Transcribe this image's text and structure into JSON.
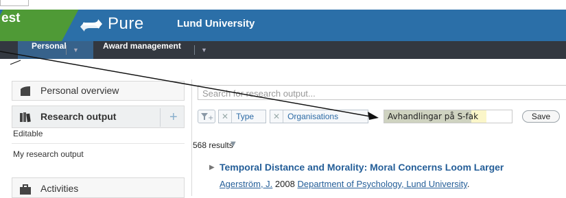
{
  "header": {
    "environment_label": "est",
    "product_name": "Pure",
    "organization": "Lund University"
  },
  "nav": {
    "personal": "Personal",
    "award_management": "Award management"
  },
  "sidebar": {
    "overview": "Personal overview",
    "research_output": "Research output",
    "editable": "Editable",
    "my_research_output": "My research output",
    "activities": "Activities"
  },
  "main": {
    "search_placeholder": "Search for research output...",
    "filters": {
      "type": "Type",
      "organisations": "Organisations",
      "saved_filter_value": "Avhandlingar på S-fak",
      "save_label": "Save"
    },
    "results_count": "568 results",
    "result": {
      "title": "Temporal Distance and Morality: Moral Concerns Loom Larger",
      "author": "Agerström, J.",
      "year": "2008",
      "department": "Department of Psychology, Lund University",
      "suffix": "."
    }
  },
  "colors": {
    "header_blue": "#2b6fa8",
    "test_green": "#4f9a36",
    "nav_dark": "#333840",
    "link_blue": "#245e98"
  }
}
